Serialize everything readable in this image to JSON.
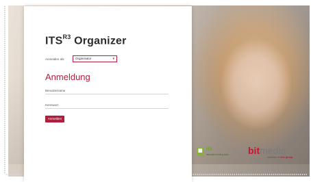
{
  "brand": {
    "name": "ITS",
    "superscript": "R3",
    "suffix": "Organizer"
  },
  "login_as": {
    "label": "Anmelden als:",
    "selected": "Organisator"
  },
  "heading": "Anmeldung",
  "fields": [
    {
      "label": "Benutzername",
      "value": ""
    },
    {
      "label": "Kennwort",
      "value": ""
    }
  ],
  "login_button": "Anmelden",
  "logos": {
    "its": {
      "name": "its",
      "tagline": "interactive testing tools"
    },
    "bitmedia": {
      "part1": "bit",
      "part2": "media",
      "tagline_prefix": "member of",
      "group": "ees group"
    }
  },
  "colors": {
    "accent": "#b01e3c",
    "its_green": "#89b03b"
  }
}
